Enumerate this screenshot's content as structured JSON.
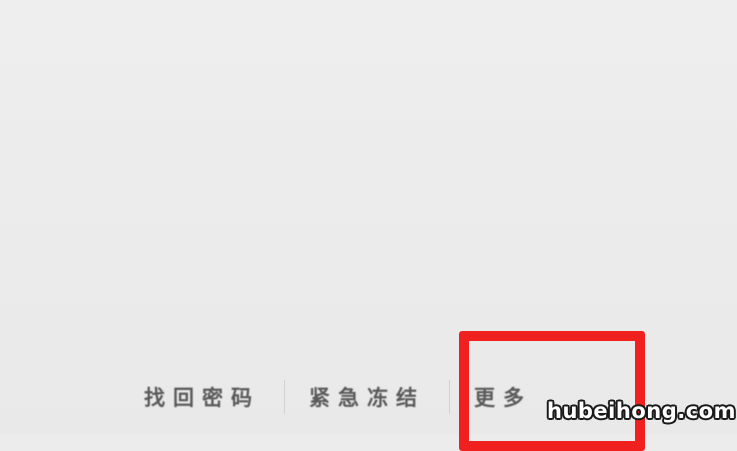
{
  "footer": {
    "links": [
      {
        "label": "找回密码"
      },
      {
        "label": "紧急冻结"
      },
      {
        "label": "更多"
      }
    ]
  },
  "highlight": {
    "color": "#f0201f"
  },
  "watermark": {
    "text": "hubeihong.com"
  }
}
